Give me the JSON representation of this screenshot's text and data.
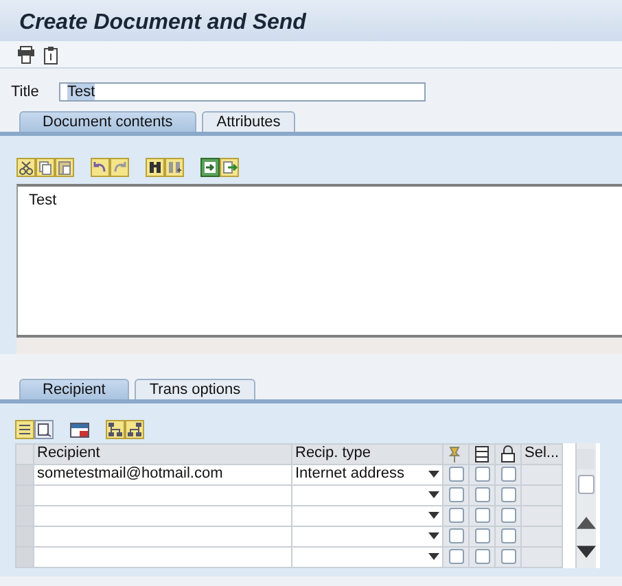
{
  "window": {
    "title": "Create Document and Send"
  },
  "title_field": {
    "label": "Title",
    "value": "Test"
  },
  "document_tabs": [
    {
      "label": "Document contents",
      "selected": true
    },
    {
      "label": "Attributes",
      "selected": false
    }
  ],
  "editor": {
    "text": "Test"
  },
  "recipient_tabs": [
    {
      "label": "Recipient",
      "selected": true
    },
    {
      "label": "Trans options",
      "selected": false
    }
  ],
  "table": {
    "columns": [
      "Recipient",
      "Recip. type",
      "Sel..."
    ],
    "rows": [
      {
        "recipient": "sometestmail@hotmail.com",
        "recip_type": "Internet address",
        "checks": [
          false,
          false,
          false
        ]
      },
      {
        "recipient": "",
        "recip_type": "",
        "checks": [
          false,
          false,
          false
        ]
      },
      {
        "recipient": "",
        "recip_type": "",
        "checks": [
          false,
          false,
          false
        ]
      },
      {
        "recipient": "",
        "recip_type": "",
        "checks": [
          false,
          false,
          false
        ]
      },
      {
        "recipient": "",
        "recip_type": "",
        "checks": [
          false,
          false,
          false
        ]
      }
    ]
  }
}
